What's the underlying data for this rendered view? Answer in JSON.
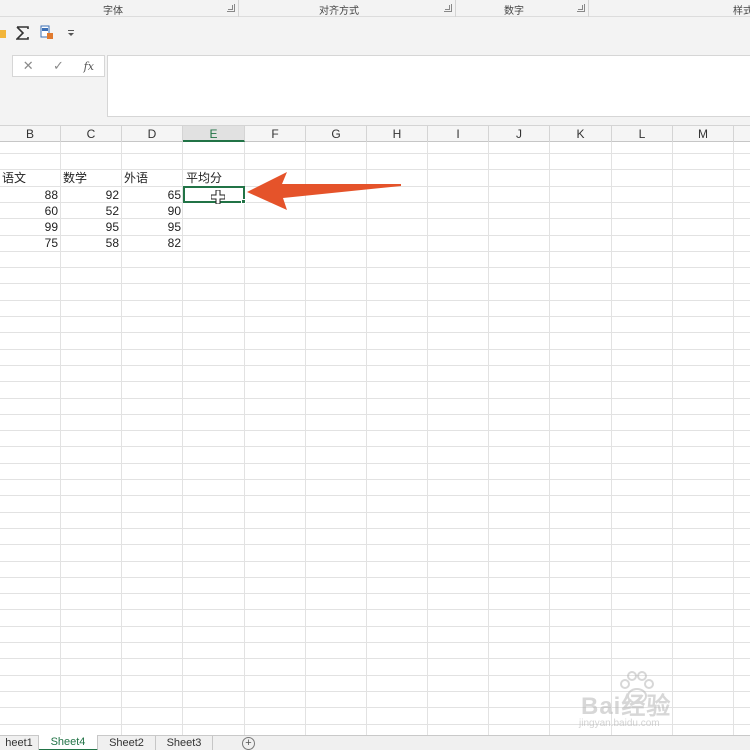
{
  "ribbon": {
    "groups": [
      "字体",
      "对齐方式",
      "数字",
      "样式"
    ]
  },
  "quick_access": {
    "icons": [
      "folder-icon",
      "autosum-icon",
      "conditional-format-icon",
      "customize-qat-icon"
    ]
  },
  "formula_bar": {
    "cancel_symbol": "✕",
    "enter_symbol": "✓",
    "fx_label": "fx",
    "formula_value": ""
  },
  "columns": [
    "B",
    "C",
    "D",
    "E",
    "F",
    "G",
    "H",
    "I",
    "J",
    "K",
    "L",
    "M"
  ],
  "active_column": "E",
  "table": {
    "headers": [
      "语文",
      "数学",
      "外语",
      "平均分"
    ],
    "rows": [
      [
        "88",
        "92",
        "65"
      ],
      [
        "60",
        "52",
        "90"
      ],
      [
        "99",
        "95",
        "95"
      ],
      [
        "75",
        "58",
        "82"
      ]
    ]
  },
  "selected_cell": {
    "address": "E3",
    "value": ""
  },
  "sheet_tabs": {
    "tabs": [
      "heet1",
      "Sheet4",
      "Sheet2",
      "Sheet3"
    ],
    "active": "Sheet4",
    "add_symbol": "+"
  },
  "annotation": {
    "arrow_color": "#e5532a"
  },
  "watermark": {
    "brand": "Bai经验",
    "url": "jingyan.baidu.com"
  },
  "colors": {
    "accent": "#217346"
  }
}
